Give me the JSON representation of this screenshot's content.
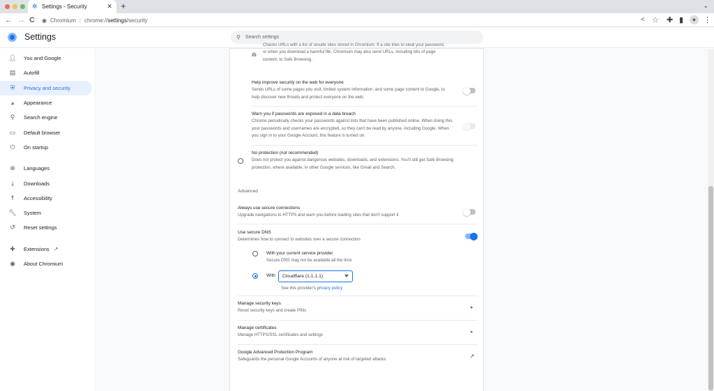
{
  "tab": {
    "title": "Settings - Security",
    "close": "✕",
    "new_tab": "+",
    "tab_menu": "⌄"
  },
  "toolbar": {
    "back": "←",
    "forward": "→",
    "reload": "C",
    "omnibox_chrome": "Chromium",
    "omnibox_scheme": "chrome://",
    "omnibox_host": "settings",
    "omnibox_path": "/security",
    "share": "<",
    "bookmark": "☆",
    "extensions": "✚",
    "sidepanel": "▮",
    "menu": "⋮"
  },
  "header": {
    "title": "Settings",
    "search_placeholder": "Search settings"
  },
  "sidebar": {
    "items": [
      {
        "label": "You and Google",
        "icon": "person-icon"
      },
      {
        "label": "Autofill",
        "icon": "clipboard-icon"
      },
      {
        "label": "Privacy and security",
        "icon": "shield-icon",
        "active": true
      },
      {
        "label": "Appearance",
        "icon": "palette-icon"
      },
      {
        "label": "Search engine",
        "icon": "search-icon"
      },
      {
        "label": "Default browser",
        "icon": "browser-icon"
      },
      {
        "label": "On startup",
        "icon": "power-icon"
      },
      {
        "label": "Languages",
        "icon": "globe-icon"
      },
      {
        "label": "Downloads",
        "icon": "download-icon"
      },
      {
        "label": "Accessibility",
        "icon": "accessibility-icon"
      },
      {
        "label": "System",
        "icon": "wrench-icon"
      },
      {
        "label": "Reset settings",
        "icon": "history-icon"
      },
      {
        "label": "Extensions",
        "icon": "puzzle-icon"
      },
      {
        "label": "About Chromium",
        "icon": "chromium-icon"
      }
    ]
  },
  "content": {
    "top_partial": {
      "line1": "Checks URLs with a list of unsafe sites stored in Chromium. If a site tries to steal your password,",
      "line2": "or when you download a harmful file, Chromium may also send URLs, including bits of page",
      "line3": "content, to Safe Browsing."
    },
    "help_improve": {
      "title": "Help improve security on the web for everyone",
      "desc": "Sends URLs of some pages you visit, limited system information, and some page content to Google, to help discover new threats and protect everyone on the web.",
      "toggle_on": false
    },
    "warn_passwords": {
      "title": "Warn you if passwords are exposed in a data breach",
      "desc": "Chrome periodically checks your passwords against lists that have been published online. When doing this, your passwords and usernames are encrypted, so they can't be read by anyone, including Google. When you sign in to your Google Account, this feature is turned on.",
      "toggle_on": false
    },
    "no_protection": {
      "title": "No protection (not recommended)",
      "desc": "Does not protect you against dangerous websites, downloads, and extensions. You'll still get Safe Browsing protection, where available, in other Google services, like Gmail and Search."
    },
    "advanced_label": "Advanced",
    "secure_connections": {
      "title": "Always use secure connections",
      "desc": "Upgrade navigations to HTTPS and warn you before loading sites that don't support it",
      "toggle_on": false
    },
    "secure_dns": {
      "title": "Use secure DNS",
      "desc": "Determines how to connect to websites over a secure connection",
      "toggle_on": true,
      "option_current_title": "With your current service provider",
      "option_current_desc": "Secure DNS may not be available all the time",
      "option_with_label": "With",
      "provider_selected": "Cloudflare (1.1.1.1)",
      "policy_prefix": "See this provider's",
      "policy_link": "privacy policy"
    },
    "manage_keys": {
      "title": "Manage security keys",
      "desc": "Reset security keys and create PINs"
    },
    "manage_certs": {
      "title": "Manage certificates",
      "desc": "Manage HTTPS/SSL certificates and settings"
    },
    "advanced_protection": {
      "title": "Google Advanced Protection Program",
      "desc": "Safeguards the personal Google Accounts of anyone at risk of targeted attacks"
    }
  }
}
